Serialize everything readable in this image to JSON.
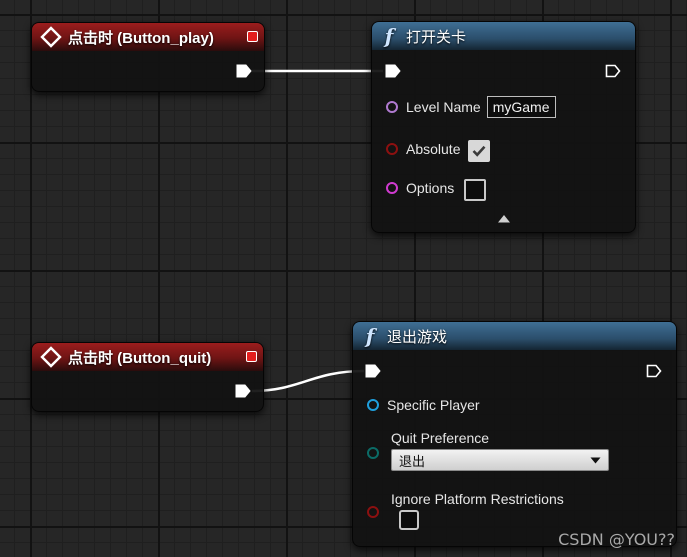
{
  "nodes": {
    "event_play": {
      "title": "点击时 (Button_play)"
    },
    "open_level": {
      "title": "打开关卡",
      "pins": {
        "level_name": "Level Name",
        "absolute": "Absolute",
        "options": "Options"
      },
      "level_name_value": "myGame",
      "absolute_checked": true,
      "options_value": ""
    },
    "event_quit": {
      "title": "点击时 (Button_quit)"
    },
    "quit_game": {
      "title": "退出游戏",
      "pins": {
        "specific_player": "Specific Player",
        "quit_preference": "Quit Preference",
        "ignore_restrictions": "Ignore Platform Restrictions"
      },
      "quit_preference_value": "退出",
      "ignore_restrictions_checked": false
    }
  },
  "icons": {
    "function": "f",
    "event": "event-diamond-icon",
    "exec": "exec-pin-icon"
  },
  "colors": {
    "event_header": "#9b1d1d",
    "function_header": "#3f6f94",
    "string_pin": "#b07ad0",
    "bool_pin": "#8c1010",
    "struct_pin": "#d03bd0",
    "object_pin": "#1f9fdd",
    "byte_pin": "#0b6b66"
  },
  "watermark": "CSDN @YOU??"
}
